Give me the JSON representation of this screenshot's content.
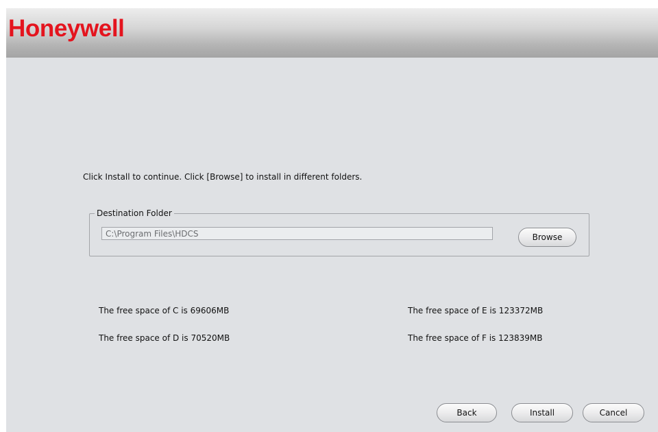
{
  "brand": {
    "logo_text": "Honeywell",
    "logo_color": "#e4141e"
  },
  "instruction": "Click Install to continue. Click [Browse] to install in different folders.",
  "destination": {
    "group_label": "Destination Folder",
    "path_value": "C:\\Program Files\\HDCS",
    "browse_label": "Browse"
  },
  "free_space": [
    {
      "drive": "C",
      "text": "The free space of C is 69606MB"
    },
    {
      "drive": "D",
      "text": "The free space of D is 70520MB"
    },
    {
      "drive": "E",
      "text": "The free space of E is 123372MB"
    },
    {
      "drive": "F",
      "text": "The free space of F is 123839MB"
    }
  ],
  "footer": {
    "back_label": "Back",
    "install_label": "Install",
    "cancel_label": "Cancel"
  },
  "colors": {
    "window_background": "#dfe1e4",
    "banner_gradient_top": "#ededed",
    "banner_gradient_bottom": "#a4a4a4"
  }
}
